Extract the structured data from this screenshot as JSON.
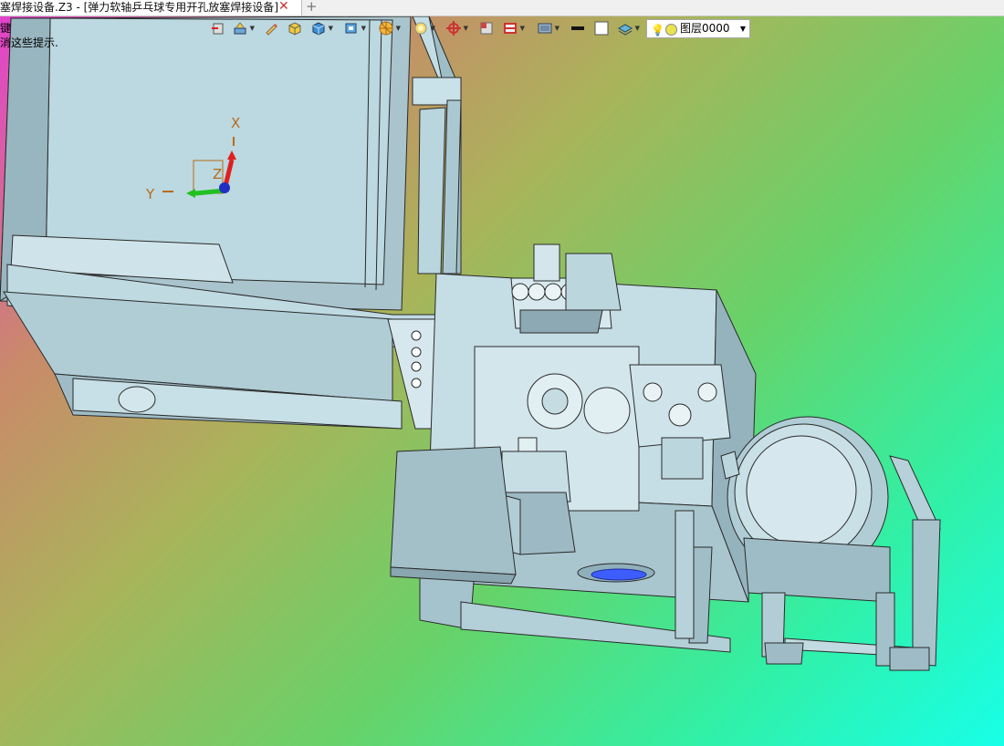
{
  "tab": {
    "title": "塞焊接设备.Z3 - [弹力软轴乒乓球专用开孔放塞焊接设备]",
    "close_glyph": "✕",
    "new_tab_glyph": "+"
  },
  "hints": {
    "line1": "键",
    "line2": "消这些提示."
  },
  "toolbar": {
    "icons": [
      "exit-sketch-icon",
      "move-icon",
      "pencil-icon",
      "solid-shade-icon",
      "box-view-icon",
      "view-cube-icon",
      "render-icon",
      "light-icon",
      "origin-icon",
      "section-icon",
      "plane-icon",
      "display-icon",
      "line-color-icon",
      "fill-color-icon",
      "layer-stack-icon"
    ],
    "layer_label": "图层0000"
  },
  "axes": {
    "x": "X",
    "y": "Y",
    "z": "Z"
  },
  "colors": {
    "model_fill": "#b5d3dc",
    "model_edge": "#2a2a2a",
    "axis_x": "#e02020",
    "axis_y": "#22c022",
    "axis_z": "#2030c0",
    "axis_label": "#b86b1a"
  }
}
